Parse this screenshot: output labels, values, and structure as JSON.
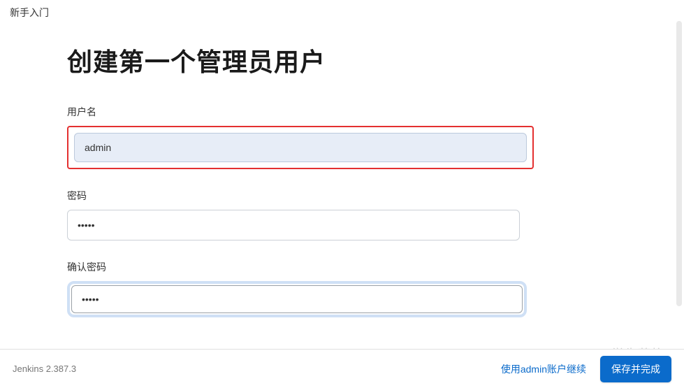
{
  "header": {
    "breadcrumb": "新手入门"
  },
  "page": {
    "title": "创建第一个管理员用户"
  },
  "form": {
    "username": {
      "label": "用户名",
      "value": "admin"
    },
    "password": {
      "label": "密码",
      "value": "•••••"
    },
    "confirm_password": {
      "label": "确认密码",
      "value": "•••••"
    }
  },
  "footer": {
    "version": "Jenkins 2.387.3",
    "skip_link": "使用admin账户继续",
    "submit": "保存并完成"
  },
  "watermark": "CSDN @学生董格"
}
